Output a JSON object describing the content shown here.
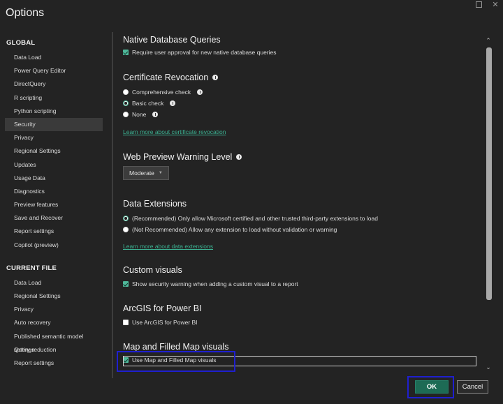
{
  "dialog": {
    "title": "Options"
  },
  "window_controls": {
    "maximize_icon": "maximize-icon",
    "close_glyph": "✕"
  },
  "sidebar": {
    "global_header": "GLOBAL",
    "global_items": [
      {
        "label": "Data Load"
      },
      {
        "label": "Power Query Editor"
      },
      {
        "label": "DirectQuery"
      },
      {
        "label": "R scripting"
      },
      {
        "label": "Python scripting"
      },
      {
        "label": "Security",
        "selected": true
      },
      {
        "label": "Privacy"
      },
      {
        "label": "Regional Settings"
      },
      {
        "label": "Updates"
      },
      {
        "label": "Usage Data"
      },
      {
        "label": "Diagnostics"
      },
      {
        "label": "Preview features"
      },
      {
        "label": "Save and Recover"
      },
      {
        "label": "Report settings"
      },
      {
        "label": "Copilot (preview)"
      }
    ],
    "current_file_header": "CURRENT FILE",
    "current_file_items": [
      {
        "label": "Data Load"
      },
      {
        "label": "Regional Settings"
      },
      {
        "label": "Privacy"
      },
      {
        "label": "Auto recovery"
      },
      {
        "label": "Published semantic model settings"
      },
      {
        "label": "Query reduction"
      },
      {
        "label": "Report settings"
      }
    ]
  },
  "content": {
    "native_db": {
      "title": "Native Database Queries",
      "option": {
        "label": "Require user approval for new native database queries",
        "checked": true
      }
    },
    "cert_revocation": {
      "title": "Certificate Revocation",
      "options": [
        {
          "label": "Comprehensive check",
          "selected": false
        },
        {
          "label": "Basic check",
          "selected": true
        },
        {
          "label": "None",
          "selected": false
        }
      ],
      "link": "Learn more about certificate revocation"
    },
    "web_preview": {
      "title": "Web Preview Warning Level",
      "selected": "Moderate"
    },
    "data_extensions": {
      "title": "Data Extensions",
      "options": [
        {
          "label": "(Recommended) Only allow Microsoft certified and other trusted third-party extensions to load",
          "selected": true
        },
        {
          "label": "(Not Recommended) Allow any extension to load without validation or warning",
          "selected": false
        }
      ],
      "link": "Learn more about data extensions"
    },
    "custom_visuals": {
      "title": "Custom visuals",
      "option": {
        "label": "Show security warning when adding a custom visual to a report",
        "checked": true
      }
    },
    "arcgis": {
      "title": "ArcGIS for Power BI",
      "option": {
        "label": "Use ArcGIS for Power BI",
        "checked": false
      }
    },
    "map_visuals": {
      "title": "Map and Filled Map visuals",
      "option": {
        "label": "Use Map and Filled Map visuals",
        "checked": true
      }
    }
  },
  "footer": {
    "ok_label": "OK",
    "cancel_label": "Cancel"
  },
  "colors": {
    "accent": "#1d6b55",
    "link": "#3bb191",
    "highlight_box": "#1f1fcf"
  }
}
